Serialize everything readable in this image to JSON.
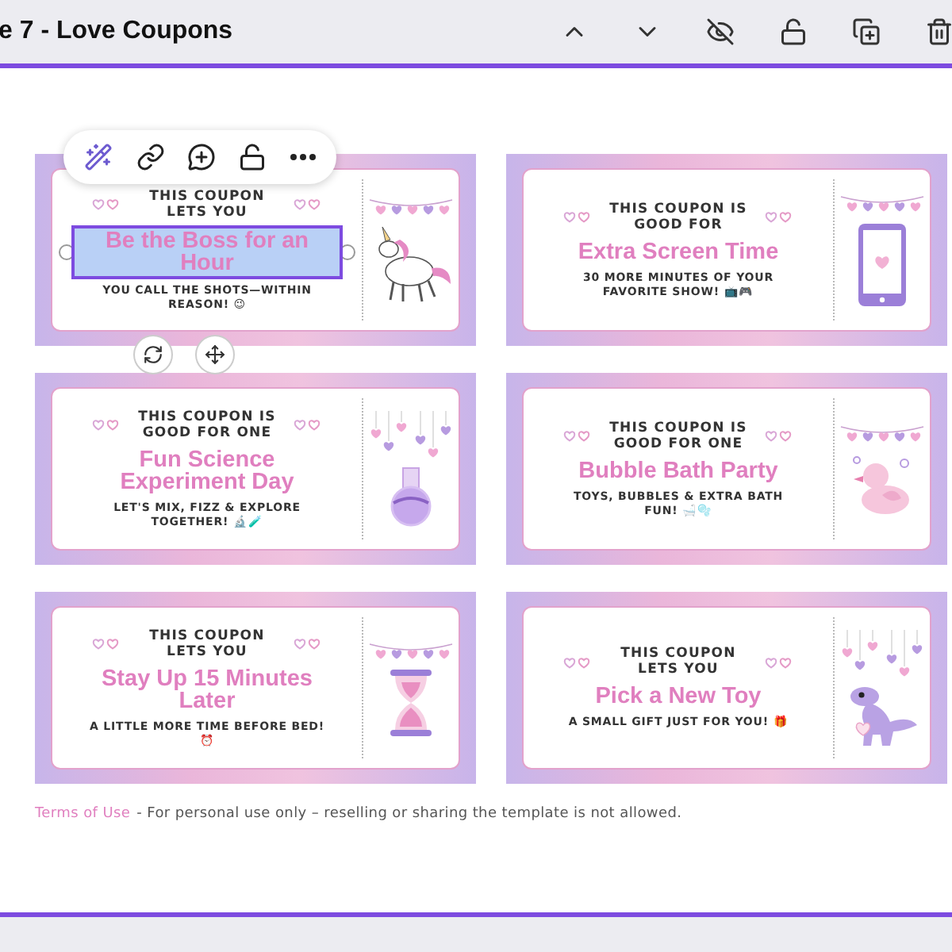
{
  "header": {
    "title": "e 7 - Love Coupons"
  },
  "coupons": [
    {
      "heading": "THIS COUPON LETS YOU",
      "title": "Be the Boss for an Hour",
      "subtitle": "YOU CALL THE SHOTS—WITHIN REASON! 😉",
      "kind": "unicorn",
      "selected": true
    },
    {
      "heading": "THIS COUPON IS GOOD FOR",
      "title": "Extra Screen Time",
      "subtitle": "30 MORE MINUTES OF YOUR FAVORITE SHOW! 📺🎮",
      "kind": "tablet",
      "selected": false
    },
    {
      "heading": "THIS COUPON IS GOOD FOR ONE",
      "title": "Fun Science Experiment Day",
      "subtitle": "LET'S MIX, FIZZ & EXPLORE TOGETHER! 🔬🧪",
      "kind": "flask",
      "selected": false
    },
    {
      "heading": "THIS COUPON IS GOOD FOR ONE",
      "title": "Bubble Bath Party",
      "subtitle": "TOYS, BUBBLES & EXTRA BATH FUN! 🛁🫧",
      "kind": "duck",
      "selected": false
    },
    {
      "heading": "THIS COUPON LETS YOU",
      "title": "Stay Up 15 Minutes Later",
      "subtitle": "A LITTLE MORE TIME BEFORE BED! ⏰",
      "kind": "hourglass",
      "selected": false
    },
    {
      "heading": "THIS COUPON LETS YOU",
      "title": "Pick a New Toy",
      "subtitle": "A SMALL GIFT JUST FOR YOU! 🎁",
      "kind": "dinosaur",
      "selected": false
    }
  ],
  "footer": {
    "link": "Terms of Use",
    "note": "- For personal use only – reselling or sharing the template is not allowed."
  }
}
